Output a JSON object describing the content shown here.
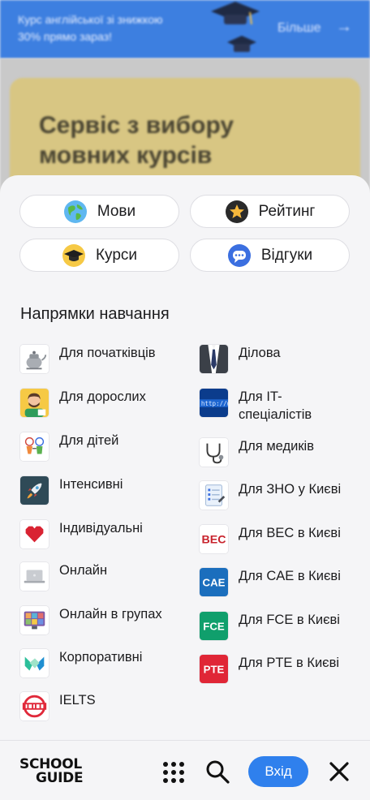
{
  "promo": {
    "text": "Курс англійської зі знижкою 30% прямо зараз!",
    "more_label": "Більше"
  },
  "hero": {
    "title": "Сервіс з вибору мовних курсів"
  },
  "quick_links": [
    {
      "label": "Мови",
      "icon": "globe-icon"
    },
    {
      "label": "Рейтинг",
      "icon": "star-icon"
    },
    {
      "label": "Курси",
      "icon": "graduation-cap-icon"
    },
    {
      "label": "Відгуки",
      "icon": "chat-bubble-icon"
    }
  ],
  "section_title": "Напрямки навчання",
  "directions_left": [
    {
      "label": "Для початківців",
      "icon": "kettle-icon"
    },
    {
      "label": "Для дорослих",
      "icon": "adult-man-icon"
    },
    {
      "label": "Для дітей",
      "icon": "kids-drawing-icon"
    },
    {
      "label": "Інтенсивні",
      "icon": "rocket-icon"
    },
    {
      "label": "Індивідуальні",
      "icon": "pixel-heart-icon"
    },
    {
      "label": "Онлайн",
      "icon": "laptop-icon"
    },
    {
      "label": "Онлайн в групах",
      "icon": "video-call-icon"
    },
    {
      "label": "Корпоративні",
      "icon": "handshake-icon"
    },
    {
      "label": "IELTS",
      "icon": "ielts-logo-icon"
    }
  ],
  "directions_right": [
    {
      "label": "Ділова",
      "icon": "suit-tie-icon"
    },
    {
      "label": "Для IT-спеціалістів",
      "icon": "http-screen-icon"
    },
    {
      "label": "Для медиків",
      "icon": "stethoscope-icon"
    },
    {
      "label": "Для ЗНО у Києві",
      "icon": "test-sheet-icon"
    },
    {
      "label": "Для BEC в Києві",
      "icon": "bec-logo-icon",
      "badge": "BEC"
    },
    {
      "label": "Для CAE в Києві",
      "icon": "cae-logo-icon",
      "badge": "CAE"
    },
    {
      "label": "Для FCE в Києві",
      "icon": "fce-logo-icon",
      "badge": "FCE"
    },
    {
      "label": "Для PTE в Києві",
      "icon": "pte-logo-icon",
      "badge": "PTE"
    }
  ],
  "bottom_bar": {
    "logo_line1": "SCHOOL",
    "logo_line2": "GUIDE",
    "login_label": "Вхід"
  },
  "colors": {
    "accent": "#2f80ed",
    "promo_bg": "#3d7fe0",
    "hero_bg": "#d8c683",
    "sheet_bg": "#f5f5f7"
  }
}
